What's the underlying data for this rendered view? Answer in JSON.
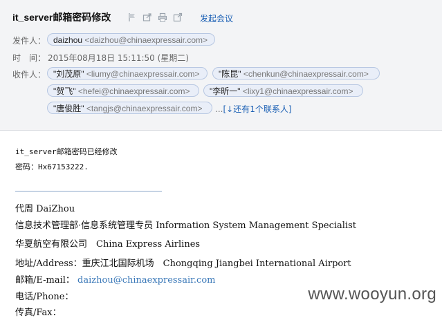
{
  "email": {
    "subject": "it_server邮箱密码修改",
    "meeting_label": "发起会议",
    "sender_label": "发件人：",
    "sender_chip": {
      "name": "daizhou",
      "address": "<daizhou@chinaexpressair.com>"
    },
    "time_label": "时　间：",
    "datetime": "2015年08月18日 15:11:50 (星期二)",
    "recipients_label": "收件人：",
    "recipients": [
      {
        "name": "\"刘茂原\"",
        "address": "<liumy@chinaexpressair.com>"
      },
      {
        "name": "\"陈昆\"",
        "address": "<chenkun@chinaexpressair.com>"
      },
      {
        "name": "\"贺飞\"",
        "address": "<hefei@chinaexpressair.com>"
      },
      {
        "name": "\"李昕一\"",
        "address": "<lixy1@chinaexpressair.com>"
      },
      {
        "name": "\"唐俊胜\"",
        "address": "<tangjs@chinaexpressair.com>"
      }
    ],
    "more_dots": "...",
    "more_link": "[↓还有1个联系人]"
  },
  "icons": [
    "flag-icon",
    "forward-icon",
    "print-icon",
    "new-window-icon"
  ],
  "body": {
    "line1": "it_server邮箱密码已经修改",
    "line2": "密码：Hx67153222."
  },
  "signature": {
    "name": "代周 DaiZhou",
    "title": "信息技术管理部·信息系统管理专员 Information System Management Specialist",
    "company": "华夏航空有限公司　China Express Airlines",
    "address": "地址/Address：重庆江北国际机场　Chongqing Jiangbei International Airport",
    "email_label": "邮箱/E-mail：",
    "email": "daizhou@chinaexpressair.com",
    "phone_label": "电话/Phone：",
    "fax_label": "传真/Fax："
  },
  "watermark": "www.wooyun.org"
}
